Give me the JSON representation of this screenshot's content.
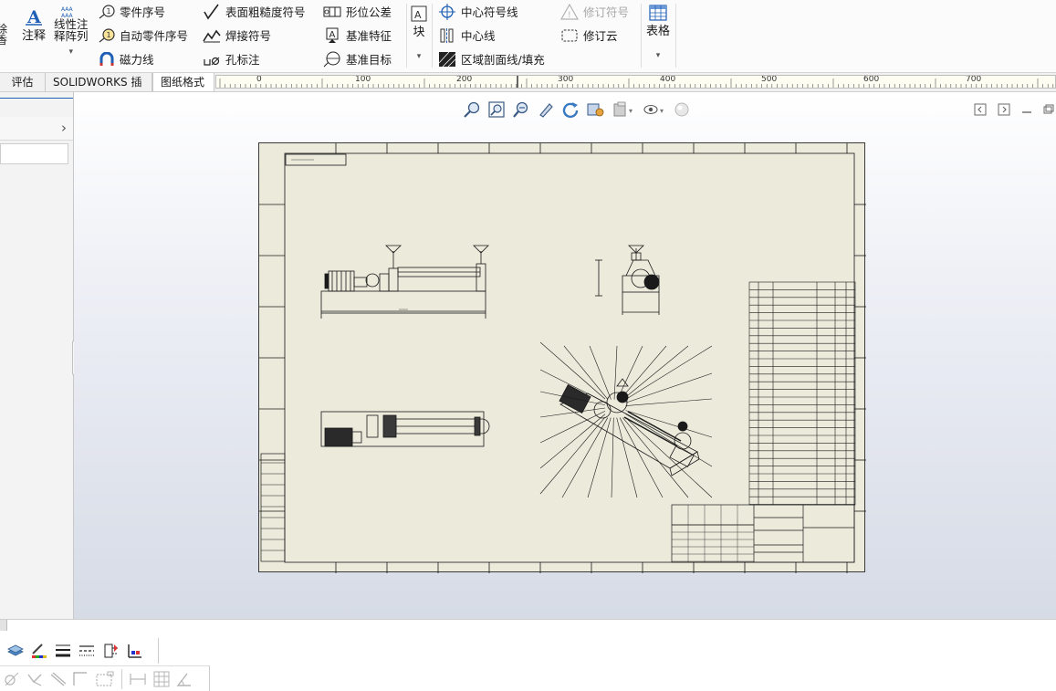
{
  "ribbon": {
    "partial_left": [
      "涂",
      "除",
      "香"
    ],
    "annotation_label": "注释",
    "linear_pattern_label": "线性注\n释阵列",
    "group1": {
      "balloon": "零件序号",
      "auto_balloon": "自动零件序号",
      "magnetic_line": "磁力线"
    },
    "group2": {
      "surface_finish": "表面粗糙度符号",
      "weld_symbol": "焊接符号",
      "hole_callout": "孔标注"
    },
    "group3": {
      "gtol": "形位公差",
      "datum_feature": "基准特征",
      "datum_target": "基准目标"
    },
    "block_label": "块",
    "group4": {
      "center_mark": "中心符号线",
      "centerline": "中心线",
      "area_hatch": "区域剖面线/填充"
    },
    "group5": {
      "revision_symbol": "修订符号",
      "revision_cloud": "修订云"
    },
    "table_label": "表格"
  },
  "tabs": [
    "评估",
    "SOLIDWORKS 插件",
    "图纸格式"
  ],
  "ruler": {
    "labels": [
      "0",
      "100",
      "200",
      "300",
      "400",
      "500",
      "600",
      "700"
    ]
  },
  "view_toolbar": {
    "icons": [
      "zoom-to-fit-icon",
      "zoom-to-area-icon",
      "zoom-in-out-icon",
      "select-icon",
      "rotate-icon",
      "rebuild-icon",
      "display-style-icon",
      "hide-show-icon",
      "appearance-icon"
    ]
  },
  "colors": {
    "sheet": "#ebeadb",
    "lines": "#1a1a1a",
    "accent": "#1f5fb5"
  },
  "bottom_toolbar": {
    "row1_icons": [
      "layer-icon",
      "line-color-icon",
      "line-thickness-icon",
      "line-style-icon",
      "hide-show-edges-icon",
      "color-display-icon"
    ],
    "row2_icons": [
      "line-icon",
      "angle-line-icon",
      "double-line-icon",
      "corner-rect-icon",
      "dashed-rect-icon",
      "dimension-icon",
      "grid-icon",
      "angle-icon"
    ]
  }
}
